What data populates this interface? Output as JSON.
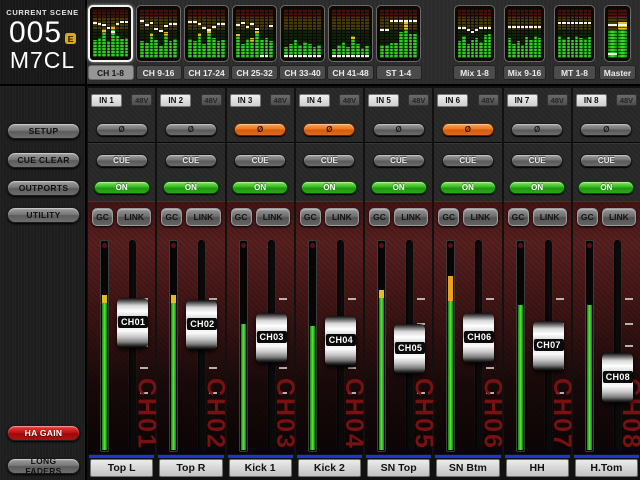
{
  "scene": {
    "label": "CURRENT SCENE",
    "number": "005",
    "edit_badge": "E",
    "console": "M7CL"
  },
  "colors": {
    "meter_green": "#3ede2c",
    "meter_yellow": "#e2c01c",
    "meter_orange": "#f0a020",
    "phase_orange": "#ee7722",
    "on_green": "#34bc20",
    "ha_gain_red": "#c01212",
    "channel_blue": "#2433cc"
  },
  "sidebar": {
    "items": [
      {
        "label": "SETUP"
      },
      {
        "label": "CUE CLEAR"
      },
      {
        "label": "OUTPORTS"
      },
      {
        "label": "UTILITY"
      }
    ],
    "bottom": [
      {
        "label": "HA GAIN",
        "style": "red"
      },
      {
        "label": "LONG FADERS",
        "style": "gray"
      }
    ]
  },
  "strip_controls": {
    "phantom": "48V",
    "phase": "Ø",
    "cue": "CUE",
    "on": "ON",
    "gc": "GC",
    "link": "LINK"
  },
  "tabs": [
    {
      "label": "CH 1-8",
      "selected": true,
      "group": "input",
      "bars": [
        {
          "g": 36,
          "m": 70
        },
        {
          "g": 40,
          "m": 68
        },
        {
          "g": 52,
          "y": 8,
          "m": 66
        },
        {
          "g": 34,
          "m": 60
        },
        {
          "g": 58,
          "y": 9,
          "m": 52
        },
        {
          "g": 44,
          "m": 68
        },
        {
          "g": 38,
          "m": 72
        },
        {
          "g": 40,
          "m": 72
        }
      ]
    },
    {
      "label": "CH 9-16",
      "group": "input",
      "bars": [
        {
          "g": 34,
          "m": 74
        },
        {
          "g": 30,
          "m": 66
        },
        {
          "g": 44,
          "y": 7,
          "m": 70
        },
        {
          "g": 36,
          "m": 58
        },
        {
          "g": 24,
          "m": 54
        },
        {
          "g": 46,
          "y": 8,
          "m": 64
        },
        {
          "g": 34,
          "m": 68
        },
        {
          "g": 38,
          "m": 68
        }
      ]
    },
    {
      "label": "CH 17-24",
      "group": "input",
      "bars": [
        {
          "g": 38,
          "m": 72
        },
        {
          "g": 34,
          "m": 72
        },
        {
          "g": 44,
          "y": 7,
          "m": 68
        },
        {
          "g": 28,
          "m": 60
        },
        {
          "g": 48,
          "y": 8,
          "m": 56
        },
        {
          "g": 40,
          "m": 62
        },
        {
          "g": 34,
          "m": 68
        },
        {
          "g": 36,
          "m": 68
        }
      ]
    },
    {
      "label": "CH 25-32",
      "group": "input",
      "bars": [
        {
          "g": 44,
          "y": 6,
          "m": 66
        },
        {
          "g": 28,
          "m": 70
        },
        {
          "g": 38,
          "m": 62
        },
        {
          "g": 34,
          "y": 6,
          "m": 68
        },
        {
          "g": 48,
          "y": 8,
          "m": 58
        },
        {
          "g": 36,
          "m": 2
        },
        {
          "g": 40,
          "m": 2
        },
        {
          "g": 34,
          "m": 64
        }
      ]
    },
    {
      "label": "CH 33-40",
      "group": "input",
      "bars": [
        {
          "g": 22,
          "m": 2
        },
        {
          "g": 28,
          "m": 2
        },
        {
          "g": 36,
          "m": 2
        },
        {
          "g": 26,
          "m": 2
        },
        {
          "g": 32,
          "m": 2
        },
        {
          "g": 28,
          "m": 2
        },
        {
          "g": 22,
          "m": 2
        },
        {
          "g": 26,
          "m": 2
        }
      ]
    },
    {
      "label": "CH 41-48",
      "group": "input",
      "bars": [
        {
          "g": 18,
          "m": 2
        },
        {
          "g": 26,
          "m": 2
        },
        {
          "g": 33,
          "m": 2
        },
        {
          "g": 23,
          "m": 2
        },
        {
          "g": 38,
          "y": 7,
          "m": 2
        },
        {
          "g": 28,
          "m": 2
        },
        {
          "g": 20,
          "m": 2
        },
        {
          "g": 24,
          "m": 2
        }
      ]
    },
    {
      "label": "ST 1-4",
      "group": "input",
      "bars": [
        {
          "g": 26,
          "m": 56
        },
        {
          "g": 26,
          "m": 56
        },
        {
          "g": 30,
          "m": 74
        },
        {
          "g": 30,
          "m": 74
        },
        {
          "g": 54,
          "m": 74
        },
        {
          "g": 60,
          "y": 18,
          "m": 74
        },
        {
          "g": 48,
          "m": 74
        },
        {
          "g": 50,
          "m": 74
        }
      ]
    },
    {
      "label": "Mix 1-8",
      "group": "output",
      "bars": [
        {
          "g": 34,
          "m": 60
        },
        {
          "g": 44,
          "m": 60
        },
        {
          "g": 28,
          "m": 56
        },
        {
          "g": 36,
          "m": 52
        },
        {
          "g": 40,
          "m": 56
        },
        {
          "g": 32,
          "m": 60
        },
        {
          "g": 46,
          "m": 60
        },
        {
          "g": 48,
          "m": 60
        }
      ]
    },
    {
      "label": "Mix 9-16",
      "group": "output",
      "bars": [
        {
          "g": 40,
          "m": 62
        },
        {
          "g": 28,
          "m": 62
        },
        {
          "g": 34,
          "m": 62
        },
        {
          "g": 26,
          "m": 62
        },
        {
          "g": 42,
          "m": 62
        },
        {
          "g": 36,
          "m": 62
        },
        {
          "g": 44,
          "m": 62
        },
        {
          "g": 40,
          "m": 62
        }
      ]
    },
    {
      "label": "MT 1-8",
      "group": "output",
      "bars": [
        {
          "g": 44,
          "m": 70
        },
        {
          "g": 38,
          "m": 70
        },
        {
          "g": 42,
          "m": 70
        },
        {
          "g": 36,
          "m": 70
        },
        {
          "g": 44,
          "m": 70
        },
        {
          "g": 40,
          "m": 70
        },
        {
          "g": 38,
          "m": 70
        },
        {
          "g": 42,
          "m": 70
        }
      ]
    },
    {
      "label": "Master",
      "group": "output",
      "bars": [
        {
          "g": 58,
          "m": 66,
          "m2": 6
        },
        {
          "g": 60,
          "y": 13,
          "m": 66
        }
      ]
    }
  ],
  "channels": [
    {
      "id": "CH01",
      "port": "IN 1",
      "name": "Top L",
      "phase_inverted": false,
      "meter": {
        "level": 74,
        "tip": "yellow",
        "tip_size": 4
      },
      "fader": 36
    },
    {
      "id": "CH02",
      "port": "IN 2",
      "name": "Top R",
      "phase_inverted": false,
      "meter": {
        "level": 74,
        "tip": "yellow",
        "tip_size": 4
      },
      "fader": 37
    },
    {
      "id": "CH03",
      "port": "IN 3",
      "name": "Kick 1",
      "phase_inverted": true,
      "meter": {
        "level": 60,
        "tip": null,
        "tip_size": 0
      },
      "fader": 45
    },
    {
      "id": "CH04",
      "port": "IN 4",
      "name": "Kick 2",
      "phase_inverted": true,
      "meter": {
        "level": 59,
        "tip": null,
        "tip_size": 0
      },
      "fader": 47
    },
    {
      "id": "CH05",
      "port": "IN 5",
      "name": "SN Top",
      "phase_inverted": false,
      "meter": {
        "level": 76,
        "tip": "yellow",
        "tip_size": 4
      },
      "fader": 52
    },
    {
      "id": "CH06",
      "port": "IN 6",
      "name": "SN Btm",
      "phase_inverted": true,
      "meter": {
        "level": 83,
        "tip": "orange",
        "tip_size": 12
      },
      "fader": 45
    },
    {
      "id": "CH07",
      "port": "IN 7",
      "name": "HH",
      "phase_inverted": false,
      "meter": {
        "level": 69,
        "tip": null,
        "tip_size": 0
      },
      "fader": 50
    },
    {
      "id": "CH08",
      "port": "IN 8",
      "name": "H.Tom",
      "phase_inverted": false,
      "meter": {
        "level": 69,
        "tip": null,
        "tip_size": 0
      },
      "fader": 70
    }
  ],
  "fader_ticks_pct": [
    27.5,
    39,
    49.5,
    60,
    71.5
  ]
}
